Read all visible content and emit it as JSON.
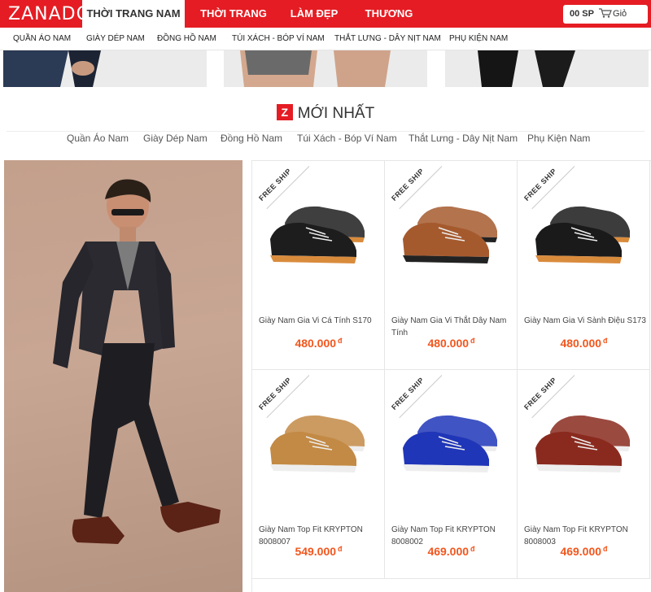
{
  "brand": {
    "logo_text": "ZANADO",
    "accent": "#e51c23",
    "price_color": "#f2561d"
  },
  "header": {
    "tabs": [
      {
        "label": "THỜI TRANG NAM",
        "active": true
      },
      {
        "label": "THỜI TRANG NỮ",
        "active": false
      },
      {
        "label": "LÀM ĐẸP",
        "active": false
      },
      {
        "label": "THƯƠNG HIỆU",
        "active": false
      }
    ],
    "cart": {
      "count": "00 SP",
      "label": "Giỏ hàng",
      "icon": "cart-icon"
    }
  },
  "subnav": {
    "items": [
      "QUẦN ÁO NAM",
      "GIÀY DÉP NAM",
      "ĐỒNG HỒ NAM",
      "TÚI XÁCH - BÓP VÍ NAM",
      "THẮT LƯNG - DÂY NỊT NAM",
      "PHỤ KIỆN NAM"
    ]
  },
  "section": {
    "badge": "Z",
    "title": "MỚI NHẤT",
    "categories": [
      "Quần Áo Nam",
      "Giày Dép Nam",
      "Đồng Hồ Nam",
      "Túi Xách - Bóp Ví Nam",
      "Thắt Lưng - Dây Nịt Nam",
      "Phụ Kiện Nam"
    ]
  },
  "products": [
    {
      "badge": "FREE SHIP",
      "name": "Giày Nam Gia Vi Cá Tính S170",
      "price": "480.000",
      "currency": "đ",
      "shoe_color": "#1d1d1d",
      "sole_color": "#d98b3c"
    },
    {
      "badge": "FREE SHIP",
      "name": "Giày Nam Gia Vi Thắt Dây Nam Tính",
      "price": "480.000",
      "currency": "đ",
      "shoe_color": "#a55a2e",
      "sole_color": "#222"
    },
    {
      "badge": "FREE SHIP",
      "name": "Giày Nam Gia Vi Sành Điệu S173",
      "price": "480.000",
      "currency": "đ",
      "shoe_color": "#1a1a1a",
      "sole_color": "#d98b3c"
    },
    {
      "badge": "FREE SHIP",
      "name": "Giày Nam Top Fit KRYPTON 8008007",
      "price": "549.000",
      "currency": "đ",
      "shoe_color": "#c38a45",
      "sole_color": "#eeeeee"
    },
    {
      "badge": "FREE SHIP",
      "name": "Giày Nam Top Fit KRYPTON 8008002",
      "price": "469.000",
      "currency": "đ",
      "shoe_color": "#2036b8",
      "sole_color": "#eeeeee"
    },
    {
      "badge": "FREE SHIP",
      "name": "Giày Nam Top Fit KRYPTON 8008003",
      "price": "469.000",
      "currency": "đ",
      "shoe_color": "#8a2a1f",
      "sole_color": "#eeeeee"
    }
  ]
}
